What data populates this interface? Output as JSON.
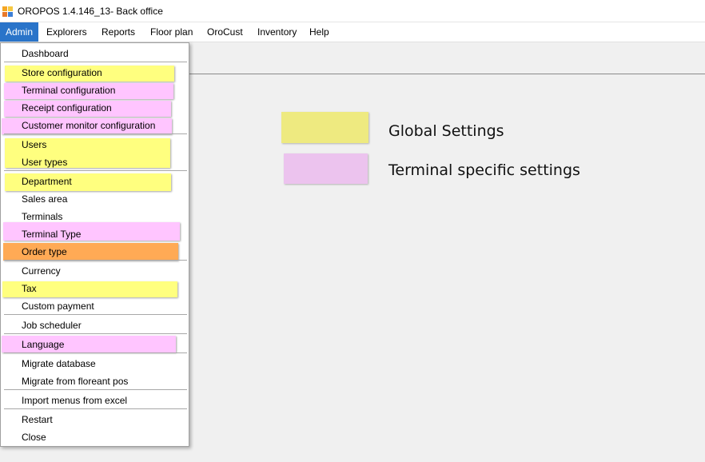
{
  "window": {
    "title": "OROPOS 1.4.146_13- Back office"
  },
  "menubar": {
    "items": [
      {
        "label": "Admin",
        "active": true
      },
      {
        "label": "Explorers"
      },
      {
        "label": "Reports"
      },
      {
        "label": "Floor plan"
      },
      {
        "label": "OroCust"
      },
      {
        "label": "Inventory"
      },
      {
        "label": "Help"
      }
    ]
  },
  "colors": {
    "global": "#ffff7f",
    "terminal": "#ffc5ff",
    "order": "#ffaa55",
    "legend_global": "#eeea80",
    "legend_terminal": "#ecc3ee",
    "active_menu": "#2a74c9"
  },
  "admin_menu": {
    "items": [
      {
        "label": "Dashboard"
      },
      {
        "label": "Store configuration",
        "highlight": "global"
      },
      {
        "label": "Terminal configuration",
        "highlight": "terminal"
      },
      {
        "label": "Receipt configuration",
        "highlight": "terminal"
      },
      {
        "label": "Customer monitor configuration",
        "highlight": "terminal"
      },
      {
        "label": "Users",
        "highlight": "global"
      },
      {
        "label": "User types",
        "highlight": "global"
      },
      {
        "label": "Department",
        "highlight": "global"
      },
      {
        "label": "Sales area"
      },
      {
        "label": "Terminals"
      },
      {
        "label": "Terminal Type",
        "highlight": "terminal"
      },
      {
        "label": "Order type",
        "highlight": "order"
      },
      {
        "label": "Currency"
      },
      {
        "label": "Tax",
        "highlight": "global"
      },
      {
        "label": "Custom payment"
      },
      {
        "label": "Job scheduler"
      },
      {
        "label": "Language",
        "highlight": "terminal"
      },
      {
        "label": "Migrate database"
      },
      {
        "label": "Migrate from floreant pos"
      },
      {
        "label": "Import menus from excel"
      },
      {
        "label": "Restart"
      },
      {
        "label": "Close"
      }
    ]
  },
  "legend": {
    "global_label": "Global Settings",
    "terminal_label": "Terminal specific settings"
  }
}
